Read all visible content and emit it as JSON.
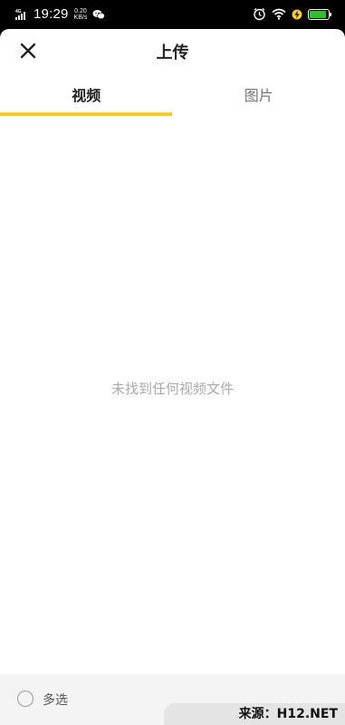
{
  "statusbar": {
    "network": "4G",
    "time": "19:29",
    "speed_value": "0.20",
    "speed_unit": "KB/s",
    "battery_level_percent": 90
  },
  "header": {
    "title": "上传"
  },
  "tabs": [
    {
      "label": "视频",
      "active": true
    },
    {
      "label": "图片",
      "active": false
    }
  ],
  "content": {
    "empty_message": "未找到任何视频文件"
  },
  "footer": {
    "multi_select_label": "多选"
  },
  "watermark": {
    "text": "来源：H12.NET"
  },
  "colors": {
    "accent": "#f2cd2e",
    "battery": "#2ec12e"
  }
}
